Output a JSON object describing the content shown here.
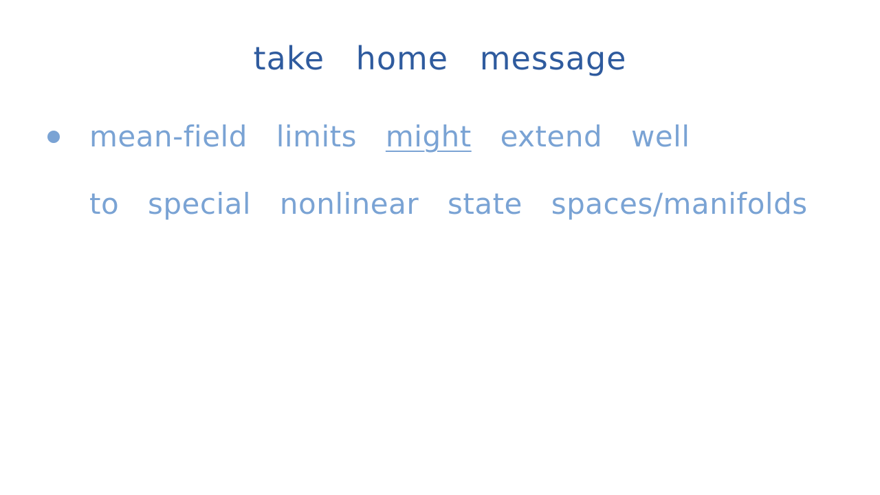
{
  "title": "take home message",
  "bullet": {
    "line1": {
      "before": "mean-field limits",
      "emphasis": "might",
      "after": "extend well"
    },
    "line2": "to special nonlinear state spaces/manifolds"
  },
  "colors": {
    "title": "#2f5b9e",
    "body": "#7aa3d4",
    "background": "#ffffff"
  }
}
